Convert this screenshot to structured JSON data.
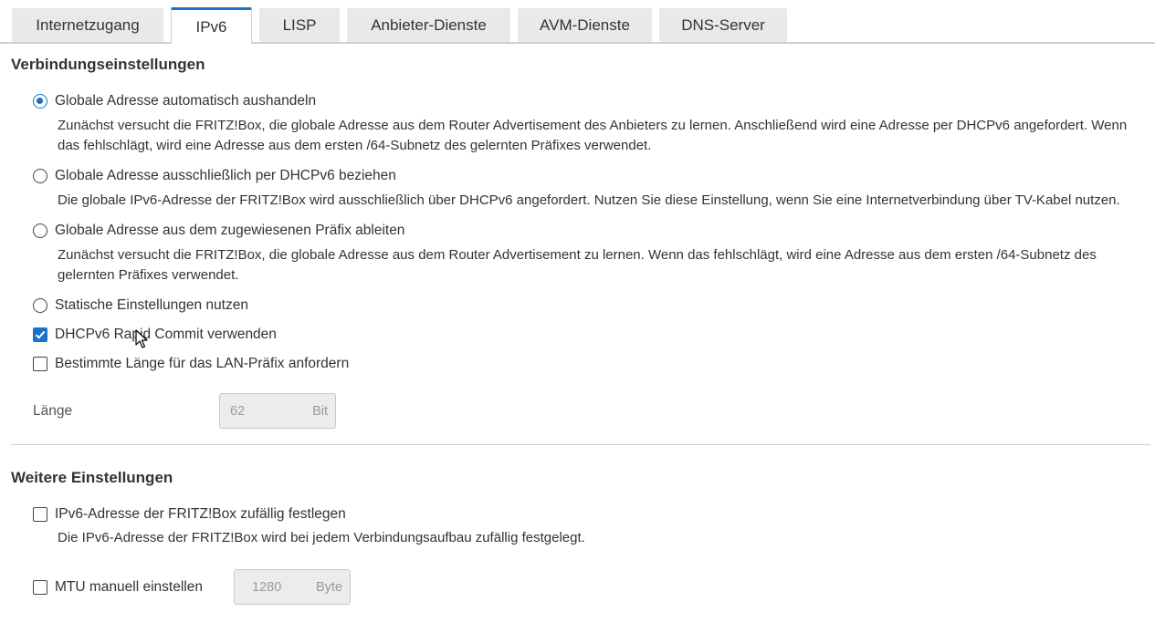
{
  "tabs": [
    {
      "label": "Internetzugang",
      "active": false
    },
    {
      "label": "IPv6",
      "active": true
    },
    {
      "label": "LISP",
      "active": false
    },
    {
      "label": "Anbieter-Dienste",
      "active": false
    },
    {
      "label": "AVM-Dienste",
      "active": false
    },
    {
      "label": "DNS-Server",
      "active": false
    }
  ],
  "connection": {
    "title": "Verbindungseinstellungen",
    "options": [
      {
        "label": "Globale Adresse automatisch aushandeln",
        "selected": true,
        "description": "Zunächst versucht die FRITZ!Box, die globale Adresse aus dem Router Advertisement des Anbieters zu lernen. Anschließend wird eine Adresse per DHCPv6 angefordert. Wenn das fehlschlägt, wird eine Adresse aus dem ersten /64-Subnetz des gelernten Präfixes verwendet."
      },
      {
        "label": "Globale Adresse ausschließlich per DHCPv6 beziehen",
        "selected": false,
        "description": "Die globale IPv6-Adresse der FRITZ!Box wird ausschließlich über DHCPv6 angefordert. Nutzen Sie diese Einstellung, wenn Sie eine Internetverbindung über TV-Kabel nutzen."
      },
      {
        "label": "Globale Adresse aus dem zugewiesenen Präfix ableiten",
        "selected": false,
        "description": "Zunächst versucht die FRITZ!Box, die globale Adresse aus dem Router Advertisement zu lernen. Wenn das fehlschlägt, wird eine Adresse aus dem ersten /64-Subnetz des gelernten Präfixes verwendet."
      },
      {
        "label": "Statische Einstellungen nutzen",
        "selected": false
      }
    ],
    "rapid_commit": {
      "label": "DHCPv6 Rapid Commit verwenden",
      "checked": true
    },
    "lan_prefix": {
      "label": "Bestimmte Länge für das LAN-Präfix anfordern",
      "checked": false
    },
    "length": {
      "label": "Länge",
      "value": "62",
      "unit": "Bit"
    }
  },
  "further": {
    "title": "Weitere Einstellungen",
    "random_ipv6": {
      "label": "IPv6-Adresse der FRITZ!Box zufällig festlegen",
      "checked": false,
      "description": "Die IPv6-Adresse der FRITZ!Box wird bei jedem Verbindungsaufbau zufällig festgelegt."
    },
    "mtu": {
      "label": "MTU manuell einstellen",
      "checked": false,
      "value": "1280",
      "unit": "Byte"
    }
  },
  "colors": {
    "accent": "#1a73c8"
  }
}
